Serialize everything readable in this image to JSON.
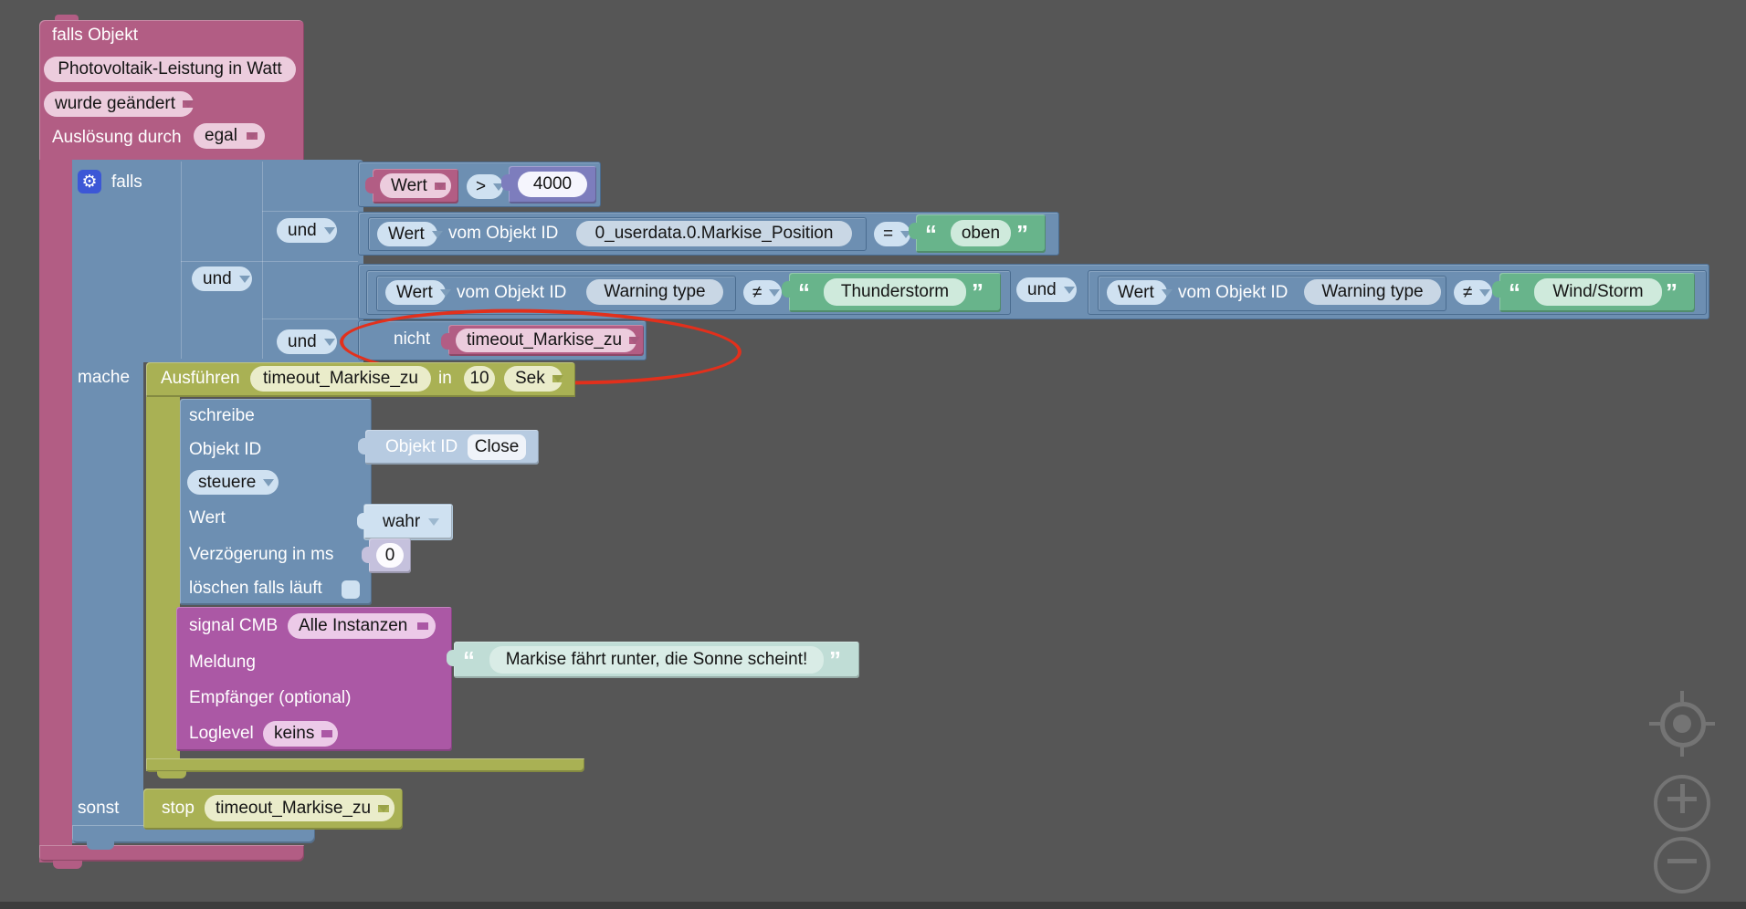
{
  "icons": {
    "gear": "⚙",
    "quote_open": "“",
    "quote_close": "”"
  },
  "colors": {
    "background": "#565656",
    "trigger_pink": "#b25d84",
    "logic_blue": "#6d8fb2",
    "string_green": "#68b48b",
    "timeout_olive": "#a9b154",
    "signal_purple": "#ab58a5",
    "number_indigo": "#7d7dbd",
    "message_teal": "#c0ddd6",
    "annotation_red": "#e2301c"
  },
  "trigger": {
    "title": "falls Objekt",
    "object_name": "Photovoltaik-Leistung in Watt",
    "event_dropdown": "wurde geändert",
    "trigger_by_label": "Auslösung durch",
    "trigger_by_value": "egal"
  },
  "if_block": {
    "falls_label": "falls",
    "mache_label": "mache",
    "sonst_label": "sonst",
    "and_label": "und"
  },
  "conditions": {
    "row1": {
      "value": "Wert",
      "operator": ">",
      "number": "4000"
    },
    "row2": {
      "value": "Wert",
      "of_object_label": "vom Objekt ID",
      "object_id": "0_userdata.0.Markise_Position",
      "operator": "=",
      "string": "oben"
    },
    "row3a": {
      "value": "Wert",
      "of_object_label": "vom Objekt ID",
      "object_id": "Warning type",
      "operator": "≠",
      "string": "Thunderstorm"
    },
    "row3b": {
      "value": "Wert",
      "of_object_label": "vom Objekt ID",
      "object_id": "Warning type",
      "operator": "≠",
      "string": "Wind/Storm"
    },
    "row4": {
      "not_label": "nicht",
      "timeout_name": "timeout_Markise_zu"
    }
  },
  "timeout_block": {
    "exec_label": "Ausführen",
    "timeout_name": "timeout_Markise_zu",
    "in_label": "in",
    "delay": "10",
    "unit": "Sek"
  },
  "control_block": {
    "title": "schreibe",
    "object_id_label": "Objekt ID",
    "mode": "steuere",
    "value_label": "Wert",
    "delay_label": "Verzögerung in ms",
    "clear_running_label": "löschen falls läuft"
  },
  "object_id_block": {
    "label": "Objekt ID",
    "value": "Close"
  },
  "value_block": {
    "value": "wahr"
  },
  "delay_block": {
    "value": "0"
  },
  "signal_block": {
    "title": "signal CMB",
    "instance": "Alle Instanzen",
    "message_label": "Meldung",
    "receiver_label": "Empfänger (optional)",
    "loglevel_label": "Loglevel",
    "loglevel_value": "keins"
  },
  "message_block": {
    "text": "Markise fährt runter, die Sonne scheint!"
  },
  "else_block": {
    "stop_label": "stop",
    "timeout_name": "timeout_Markise_zu"
  }
}
